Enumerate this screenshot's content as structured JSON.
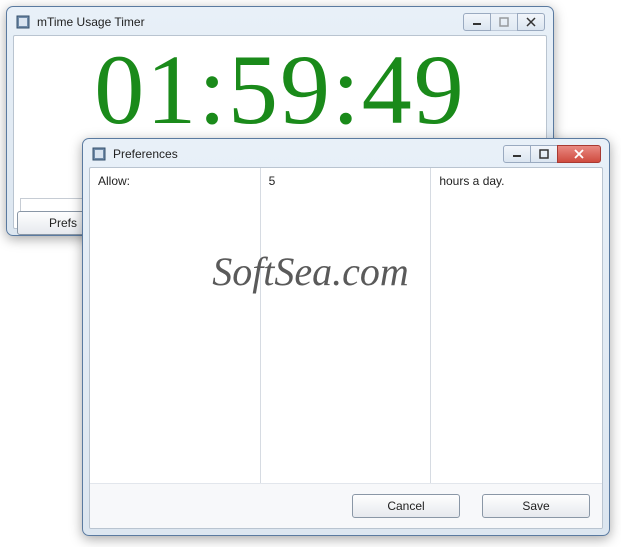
{
  "main_window": {
    "title": "mTime Usage Timer",
    "timer_text": "01:59:49",
    "prefs_button_label": "Prefs"
  },
  "prefs_window": {
    "title": "Preferences",
    "allow_label": "Allow:",
    "hours_value": "5",
    "hours_suffix": "hours a day.",
    "cancel_label": "Cancel",
    "save_label": "Save"
  },
  "watermark": "SoftSea.com"
}
